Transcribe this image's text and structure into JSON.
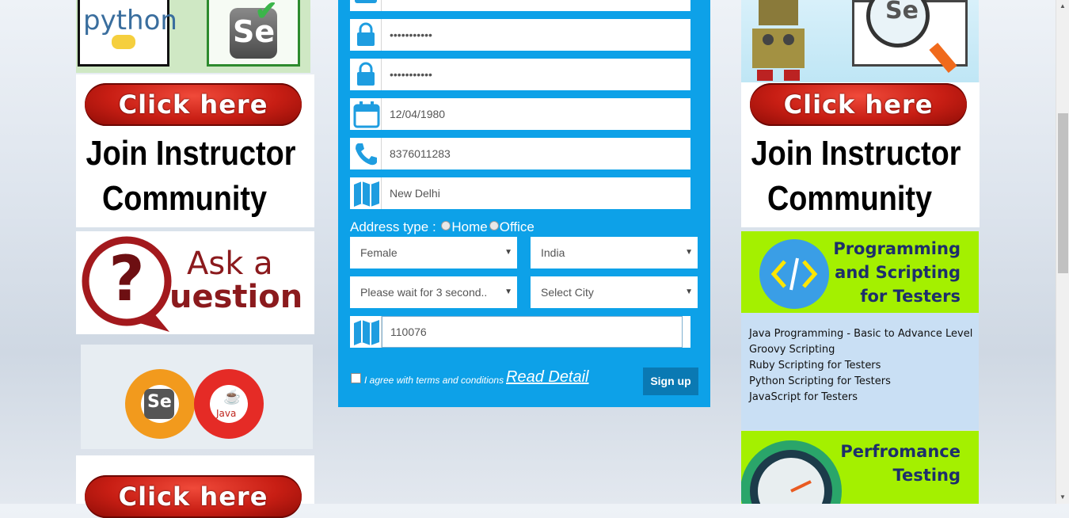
{
  "left": {
    "python_logo_text": "python",
    "selenium_logo_text": "Se",
    "click_here_1": "Click here",
    "join_line1": "Join Instructor",
    "join_line2": "Community",
    "ask_a": "Ask a",
    "ask_uestion": "uestion",
    "gear_se": "Se",
    "gear_java": "Java",
    "click_here_2": "Click here"
  },
  "form": {
    "password_value": "•••••••••••",
    "confirm_password_value": "•••••••••••",
    "dob_value": "12/04/1980",
    "phone_value": "8376011283",
    "city_value": "New Delhi",
    "address_type_label": "Address type :",
    "home_label": "Home",
    "office_label": "Office",
    "gender_selected": "Female",
    "country_selected": "India",
    "state_selected": "Please wait for 3 second..",
    "city_selected": "Select City",
    "zip_value": "110076",
    "agree_text": "I agree with terms and conditions",
    "read_detail": "Read Detail",
    "signup_label": "Sign up"
  },
  "right": {
    "robot_se": "Se",
    "click_here": "Click here",
    "join_line1": "Join Instructor",
    "join_line2": "Community",
    "prog_line1": "Programming",
    "prog_line2": "and Scripting",
    "prog_line3": "for Testers",
    "courses": [
      "Java Programming - Basic to Advance Level",
      "Groovy Scripting",
      "Ruby Scripting for Testers",
      "Python Scripting for Testers",
      "JavaScript for Testers"
    ],
    "perf_line1": "Perfromance",
    "perf_line2": "Testing"
  },
  "colors": {
    "form_bg": "#0da1e8",
    "signup_bg": "#0a79b3",
    "click_red": "#c81e14",
    "lime": "#a4f000",
    "course_bg": "#c9dff4"
  }
}
